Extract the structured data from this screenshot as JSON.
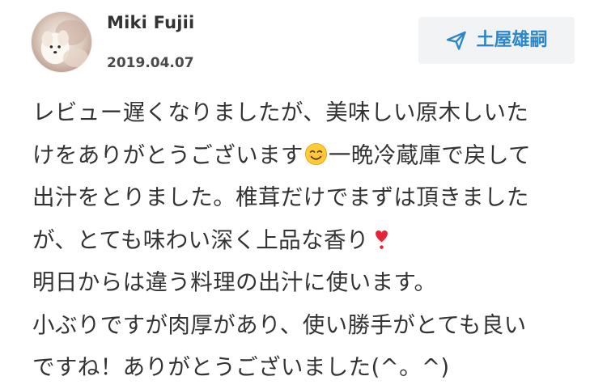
{
  "review": {
    "reviewer_name": "Miki Fujii",
    "date": "2019.04.07",
    "producer_button": {
      "icon": "paper-plane-icon",
      "label": "土屋雄嗣"
    },
    "body_lines": [
      {
        "text": "レビュー遅くなりましたが、美味しい原木しいた"
      },
      {
        "text": "けをありがとうございます",
        "emoji": "smiling-face-emoji",
        "text_after": "一晩冷蔵庫で戻して"
      },
      {
        "text": "出汁をとりました。椎茸だけでまずは頂きました"
      },
      {
        "text": "が、とても味わい深く上品な香り",
        "emoji": "heart-exclamation-emoji"
      },
      {
        "text": "明日からは違う料理の出汁に使います。"
      },
      {
        "text": "小ぶりですが肉厚があり、使い勝手がとても良い"
      },
      {
        "text": "ですね！ありがとうございました(^。^)"
      }
    ]
  },
  "colors": {
    "accent": "#2b87c9",
    "button_bg": "#f2f3f5",
    "text": "#333333"
  }
}
